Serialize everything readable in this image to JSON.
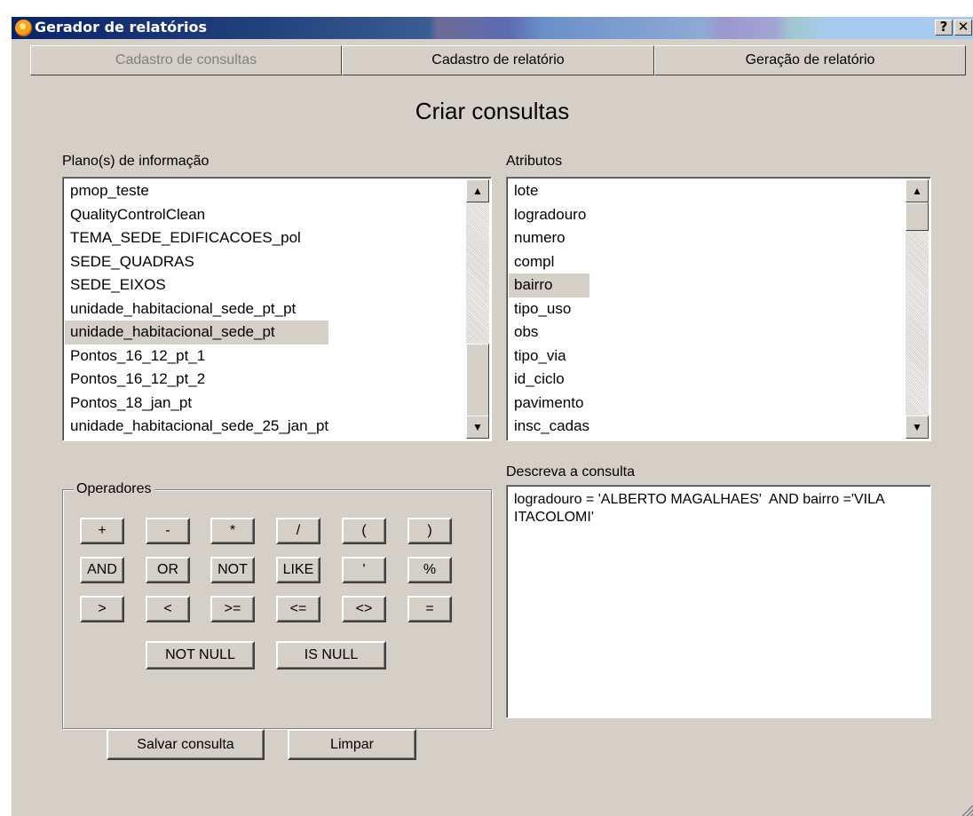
{
  "window": {
    "title": "Gerador de relatórios",
    "help_btn": "?",
    "close_btn": "✕"
  },
  "tabs": [
    {
      "label": "Cadastro de consultas",
      "active": true
    },
    {
      "label": "Cadastro de relatório",
      "active": false
    },
    {
      "label": "Geração de relatório",
      "active": false
    }
  ],
  "heading": "Criar consultas",
  "layers": {
    "label": "Plano(s) de informação",
    "items": [
      "pmop_teste",
      "QualityControlClean",
      "TEMA_SEDE_EDIFICACOES_pol",
      "SEDE_QUADRAS",
      "SEDE_EIXOS",
      "unidade_habitacional_sede_pt_pt",
      "unidade_habitacional_sede_pt",
      "Pontos_16_12_pt_1",
      "Pontos_16_12_pt_2",
      "Pontos_18_jan_pt",
      "unidade_habitacional_sede_25_jan_pt"
    ],
    "selected": "unidade_habitacional_sede_pt",
    "scroll_up": "▲",
    "scroll_down": "▼"
  },
  "attributes": {
    "label": "Atributos",
    "items": [
      "lote",
      "logradouro",
      "numero",
      "compl",
      "bairro",
      "tipo_uso",
      "obs",
      "tipo_via",
      "id_ciclo",
      "pavimento",
      "insc_cadas"
    ],
    "selected": "bairro",
    "scroll_up": "▲",
    "scroll_down": "▼"
  },
  "operators": {
    "label": "Operadores",
    "row1": [
      "+",
      "-",
      "*",
      "/",
      "(",
      ")"
    ],
    "row2": [
      "AND",
      "OR",
      "NOT",
      "LIKE",
      "'",
      "%"
    ],
    "row3": [
      ">",
      "<",
      ">=",
      "<=",
      "<>",
      "="
    ],
    "row4": [
      "NOT NULL",
      "IS NULL"
    ]
  },
  "query": {
    "label": "Descreva a consulta",
    "text": "logradouro = 'ALBERTO MAGALHAES'  AND bairro ='VILA ITACOLOMI'"
  },
  "actions": {
    "save": "Salvar consulta",
    "clear": "Limpar"
  }
}
